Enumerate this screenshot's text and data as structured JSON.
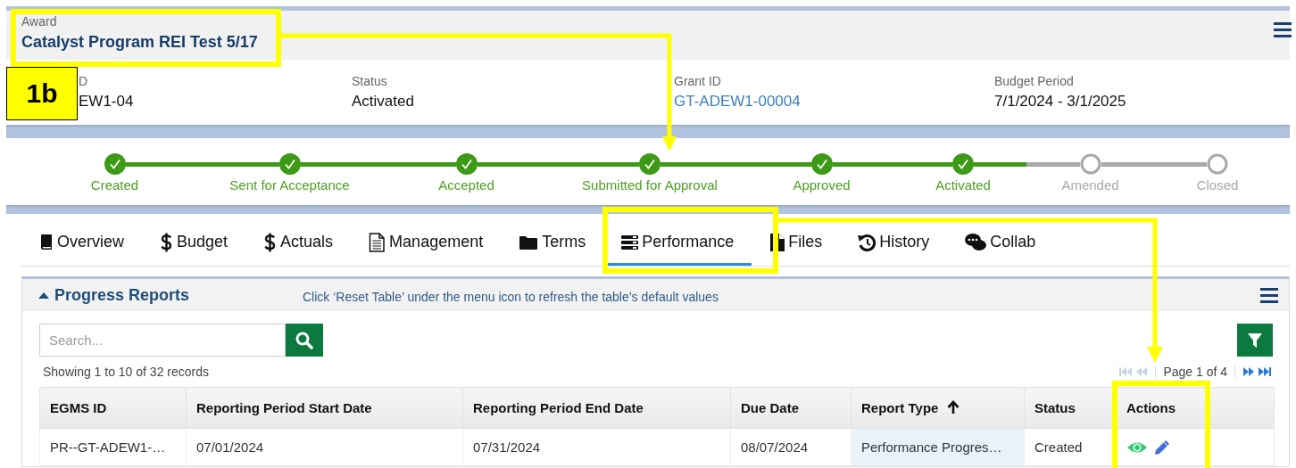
{
  "award": {
    "label": "Award",
    "title": "Catalyst Program REI Test 5/17"
  },
  "summary": [
    {
      "label": "D",
      "value": "EW1-04",
      "kind": "text"
    },
    {
      "label": "Status",
      "value": "Activated",
      "kind": "text"
    },
    {
      "label": "Grant ID",
      "value": "GT-ADEW1-00004",
      "kind": "link"
    },
    {
      "label": "Budget Period",
      "value": "7/1/2024 - 3/1/2025",
      "kind": "text"
    }
  ],
  "steps": [
    {
      "label": "Created",
      "done": true
    },
    {
      "label": "Sent for Acceptance",
      "done": true
    },
    {
      "label": "Accepted",
      "done": true
    },
    {
      "label": "Submitted for Approval",
      "done": true
    },
    {
      "label": "Approved",
      "done": true
    },
    {
      "label": "Activated",
      "done": true
    },
    {
      "label": "Amended",
      "done": false
    },
    {
      "label": "Closed",
      "done": false
    }
  ],
  "tabs": [
    {
      "label": "Overview",
      "selected": false
    },
    {
      "label": "Budget",
      "selected": false
    },
    {
      "label": "Actuals",
      "selected": false
    },
    {
      "label": "Management",
      "selected": false
    },
    {
      "label": "Terms",
      "selected": false
    },
    {
      "label": "Performance",
      "selected": true
    },
    {
      "label": "Files",
      "selected": false
    },
    {
      "label": "History",
      "selected": false
    },
    {
      "label": "Collab",
      "selected": false
    }
  ],
  "panel": {
    "title": "Progress Reports",
    "expanded": true,
    "note": "Click ‘Reset Table’ under the menu icon to refresh the table’s default values",
    "search": {
      "placeholder": "Search..."
    },
    "records": "Showing 1 to 10 of 32 records",
    "pager": {
      "text": "Page 1 of 4",
      "back_disabled": true,
      "forward_disabled": false
    },
    "table": {
      "columns": [
        {
          "label": "EGMS ID",
          "kind": "text",
          "sorted": false
        },
        {
          "label": "Reporting Period Start Date",
          "kind": "text",
          "sorted": false
        },
        {
          "label": "Reporting Period End Date",
          "kind": "text",
          "sorted": false
        },
        {
          "label": "Due Date",
          "kind": "text",
          "sorted": false
        },
        {
          "label": "Report Type",
          "kind": "text",
          "sorted": true
        },
        {
          "label": "Status",
          "kind": "text",
          "sorted": false
        },
        {
          "label": "Actions",
          "kind": "actions",
          "sorted": false
        }
      ],
      "rows": [
        {
          "cells": [
            "PR--GT-ADEW1-…",
            "07/01/2024",
            "07/31/2024",
            "08/07/2024",
            "Performance Progres…",
            "Created"
          ]
        }
      ]
    }
  },
  "callout": {
    "label": "1b"
  }
}
